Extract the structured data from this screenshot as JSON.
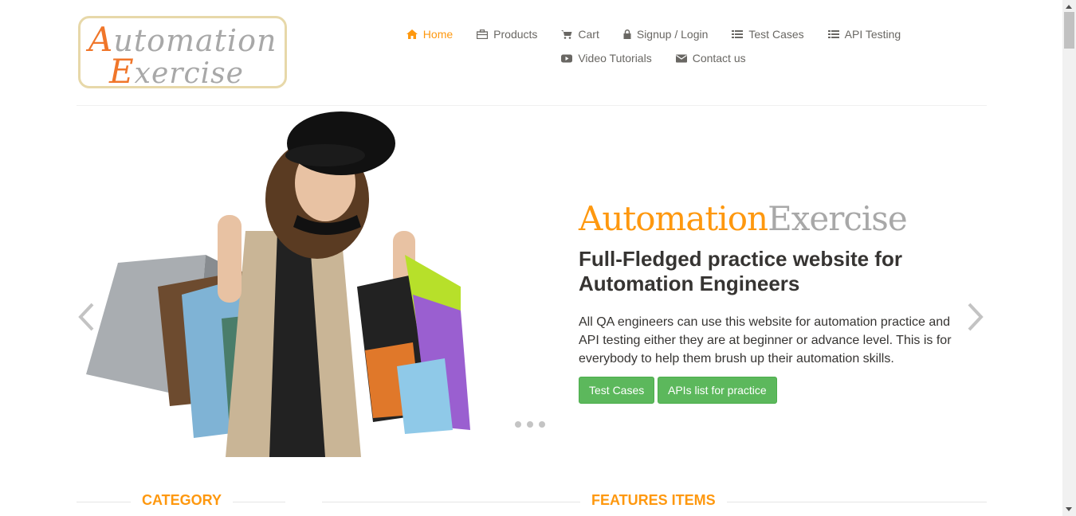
{
  "logo": {
    "line1_cap": "A",
    "line1_rest": "utomation",
    "line2_cap": "E",
    "line2_rest": "xercise"
  },
  "nav": {
    "items": [
      {
        "label": "Home",
        "icon": "home-icon",
        "active": true
      },
      {
        "label": "Products",
        "icon": "briefcase-icon"
      },
      {
        "label": "Cart",
        "icon": "cart-icon"
      },
      {
        "label": "Signup / Login",
        "icon": "lock-icon"
      },
      {
        "label": "Test Cases",
        "icon": "list-icon"
      },
      {
        "label": "API Testing",
        "icon": "list-icon"
      },
      {
        "label": "Video Tutorials",
        "icon": "youtube-icon"
      },
      {
        "label": "Contact us",
        "icon": "envelope-icon"
      }
    ]
  },
  "hero": {
    "title_part1": "Automation",
    "title_part2": "Exercise",
    "subtitle": "Full-Fledged practice website for Automation Engineers",
    "description": "All QA engineers can use this website for automation practice and API testing either they are at beginner or advance level. This is for everybody to help them brush up their automation skills.",
    "btn_test_cases": "Test Cases",
    "btn_apis": "APIs list for practice",
    "slides": 3
  },
  "sections": {
    "category": "CATEGORY",
    "features": "FEATURES ITEMS"
  },
  "colors": {
    "accent": "#FE980F",
    "button_green": "#5cb85c",
    "text_dark": "#363432",
    "nav_text": "#696763"
  }
}
